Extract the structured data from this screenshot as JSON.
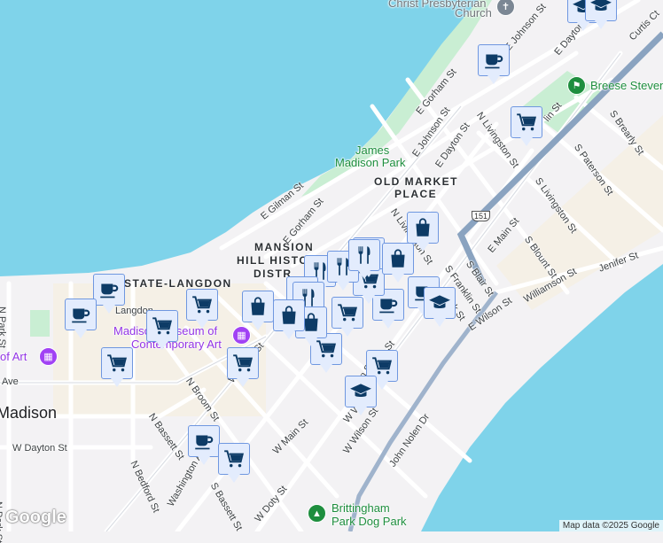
{
  "map": {
    "districts": [
      "MANSION",
      "HILL HISTO",
      "DISTR",
      "STATE-LANGDON",
      "OLD MARKET",
      "PLACE"
    ],
    "city_label": "Madison",
    "pois": {
      "museum": "Madison Museum of",
      "museum_line2": "Contemporary Art",
      "art": "of Art",
      "church_line1": "Christ Presbyterian",
      "church_line2": "Church",
      "park": "James",
      "park_line2": "Madison Park",
      "breese": "Breese Stevens",
      "dog_park_line1": "Brittingham",
      "dog_park_line2": "Park Dog Park"
    },
    "streets": [
      "E Johnson St",
      "E Dayton St",
      "Curtis Ct",
      "E Gorham St",
      "E Johnson St",
      "N Livingston St",
      "E Dayton St",
      "E Gilman St",
      "E Gorham St",
      "N Park St",
      "N Park St",
      "Langdon",
      "Ave",
      "W Dayton St",
      "N Bassett St",
      "N Broom St",
      "W Mifflin St",
      "N Bedford St",
      "Washington Ave",
      "S Bassett St",
      "W Doty St",
      "W Main St",
      "W Wilson St",
      "John Nolen Dr",
      "E Wilson St",
      "Williamson St",
      "Jenifer St",
      "S Blair St",
      "S Franklin St",
      "E Main St",
      "S Blount St",
      "S Livingston St",
      "S Paterson St",
      "S Brearly St",
      "N Livingston St",
      "Doty St",
      "W Wa",
      "Main St",
      "ck St",
      "lin St"
    ],
    "highway_shield": "151",
    "markers": [
      "coffee-icon",
      "coffee-icon",
      "coffee-icon",
      "coffee-icon",
      "coffee-icon",
      "coffee-icon",
      "cart-icon",
      "cart-icon",
      "cart-icon",
      "cart-icon",
      "cart-icon",
      "cart-icon",
      "cart-icon",
      "cart-icon",
      "cart-icon",
      "cart-icon",
      "cart-icon",
      "restaurant-icon",
      "restaurant-icon",
      "restaurant-icon",
      "restaurant-icon",
      "restaurant-icon",
      "shopping-bag-icon",
      "shopping-bag-icon",
      "shopping-bag-icon",
      "shopping-bag-icon",
      "shopping-bag-icon",
      "school-icon",
      "school-icon",
      "school-icon",
      "school-icon"
    ],
    "colors": {
      "water": "#7fd3ea",
      "land": "#f3f2f4",
      "park": "#c9eed3",
      "highway": "#8aa3c0",
      "marker_bg": "#e3ecfd",
      "marker_icon": "#0d3b66"
    },
    "logo": "Google",
    "attribution": "Map data ©2025 Google"
  }
}
